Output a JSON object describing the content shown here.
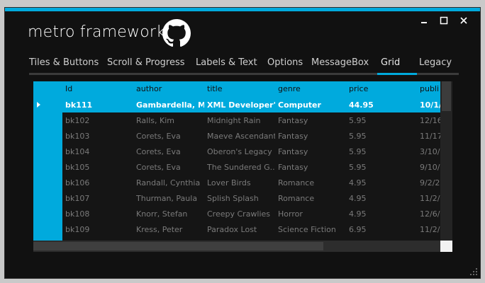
{
  "window": {
    "title": "metro framework",
    "accent_color": "#00aadd"
  },
  "controls": {
    "minimize_icon": "minimize-icon",
    "maximize_icon": "maximize-icon",
    "close_icon": "close-icon"
  },
  "tabs": [
    {
      "label": "Tiles & Buttons"
    },
    {
      "label": "Scroll & Progress"
    },
    {
      "label": "Labels & Text"
    },
    {
      "label": "Options"
    },
    {
      "label": "MessageBox"
    },
    {
      "label": "Grid",
      "active": true
    },
    {
      "label": "Legacy"
    }
  ],
  "grid": {
    "columns": [
      "Id",
      "author",
      "title",
      "genre",
      "price",
      "publi"
    ],
    "rows": [
      [
        "bk111",
        "Gambardella, M...",
        "XML Developer's...",
        "Computer",
        "44.95",
        "10/1/2"
      ],
      [
        "bk102",
        "Ralls, Kim",
        "Midnight Rain",
        "Fantasy",
        "5.95",
        "12/16/"
      ],
      [
        "bk103",
        "Corets, Eva",
        "Maeve Ascendant",
        "Fantasy",
        "5.95",
        "11/17/"
      ],
      [
        "bk104",
        "Corets, Eva",
        "Oberon's Legacy",
        "Fantasy",
        "5.95",
        "3/10/2"
      ],
      [
        "bk105",
        "Corets, Eva",
        "The Sundered G...",
        "Fantasy",
        "5.95",
        "9/10/2"
      ],
      [
        "bk106",
        "Randall, Cynthia",
        "Lover Birds",
        "Romance",
        "4.95",
        "9/2/20"
      ],
      [
        "bk107",
        "Thurman, Paula",
        "Splish Splash",
        "Romance",
        "4.95",
        "11/2/2"
      ],
      [
        "bk108",
        "Knorr, Stefan",
        "Creepy Crawlies",
        "Horror",
        "4.95",
        "12/6/2"
      ],
      [
        "bk109",
        "Kress, Peter",
        "Paradox Lost",
        "Science Fiction",
        "6.95",
        "11/2/2"
      ]
    ],
    "selected_row": 0
  }
}
